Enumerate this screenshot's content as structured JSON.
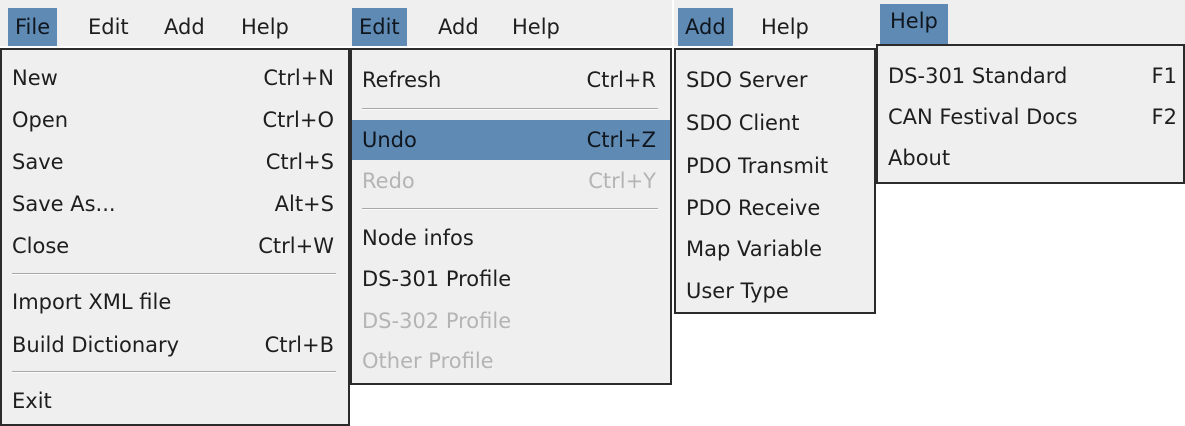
{
  "file_panel": {
    "menubar": [
      "File",
      "Edit",
      "Add",
      "Help"
    ],
    "items": [
      {
        "label": "New",
        "accel": "Ctrl+N"
      },
      {
        "label": "Open",
        "accel": "Ctrl+O"
      },
      {
        "label": "Save",
        "accel": "Ctrl+S"
      },
      {
        "label": "Save As...",
        "accel": "Alt+S"
      },
      {
        "label": "Close",
        "accel": "Ctrl+W"
      },
      {
        "label": "Import XML file",
        "accel": ""
      },
      {
        "label": "Build Dictionary",
        "accel": "Ctrl+B"
      },
      {
        "label": "Exit",
        "accel": ""
      }
    ]
  },
  "edit_panel": {
    "menubar": [
      "Edit",
      "Add",
      "Help"
    ],
    "items": [
      {
        "label": "Refresh",
        "accel": "Ctrl+R"
      },
      {
        "label": "Undo",
        "accel": "Ctrl+Z",
        "highlighted": true
      },
      {
        "label": "Redo",
        "accel": "Ctrl+Y",
        "disabled": true
      },
      {
        "label": "Node infos",
        "accel": ""
      },
      {
        "label": "DS-301 Profile",
        "accel": ""
      },
      {
        "label": "DS-302 Profile",
        "accel": "",
        "disabled": true
      },
      {
        "label": "Other Profile",
        "accel": "",
        "disabled": true
      }
    ]
  },
  "add_panel": {
    "menubar": [
      "Add",
      "Help"
    ],
    "items": [
      {
        "label": "SDO Server"
      },
      {
        "label": "SDO Client"
      },
      {
        "label": "PDO Transmit"
      },
      {
        "label": "PDO Receive"
      },
      {
        "label": "Map Variable"
      },
      {
        "label": "User Type"
      }
    ]
  },
  "help_panel": {
    "menubar": [
      "Help"
    ],
    "items": [
      {
        "label": "DS-301 Standard",
        "accel": "F1"
      },
      {
        "label": "CAN Festival Docs",
        "accel": "F2"
      },
      {
        "label": "About",
        "accel": ""
      }
    ]
  },
  "colors": {
    "highlight": "#5f8ab4",
    "menu_bg": "#efefef",
    "disabled_text": "#b4b4b4"
  }
}
